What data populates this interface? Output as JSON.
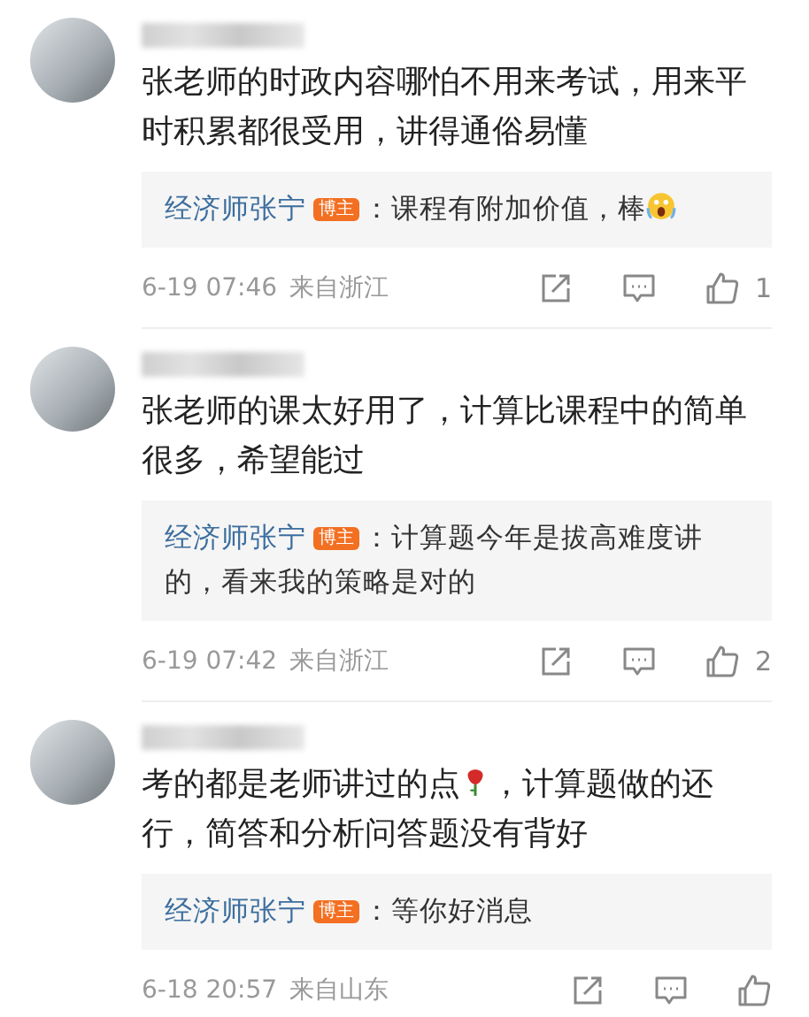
{
  "comments": [
    {
      "text": [
        {
          "kind": "text",
          "text": "张老师的时政内容哪怕不用来考试，用来平时积累都很受用，讲得通俗易懂"
        }
      ],
      "reply": {
        "author": "经济师张宁",
        "badge": "博主",
        "text": [
          {
            "kind": "text",
            "text": "：课程有附加价值，棒"
          },
          {
            "kind": "scream"
          }
        ]
      },
      "time": "6-19 07:46",
      "location": "来自浙江",
      "likes": "1"
    },
    {
      "text": [
        {
          "kind": "text",
          "text": "张老师的课太好用了，计算比课程中的简单很多，希望能过"
        }
      ],
      "reply": {
        "author": "经济师张宁",
        "badge": "博主",
        "text": [
          {
            "kind": "text",
            "text": "：计算题今年是拔高难度讲的，看来我的策略是对的"
          }
        ]
      },
      "time": "6-19 07:42",
      "location": "来自浙江",
      "likes": "2"
    },
    {
      "text": [
        {
          "kind": "text",
          "text": "考的都是老师讲过的点"
        },
        {
          "kind": "rose"
        },
        {
          "kind": "text",
          "text": "，计算题做的还行，简答和分析问答题没有背好"
        }
      ],
      "reply": {
        "author": "经济师张宁",
        "badge": "博主",
        "text": [
          {
            "kind": "text",
            "text": "：等你好消息"
          }
        ]
      },
      "time": "6-18 20:57",
      "location": "来自山东"
    }
  ]
}
